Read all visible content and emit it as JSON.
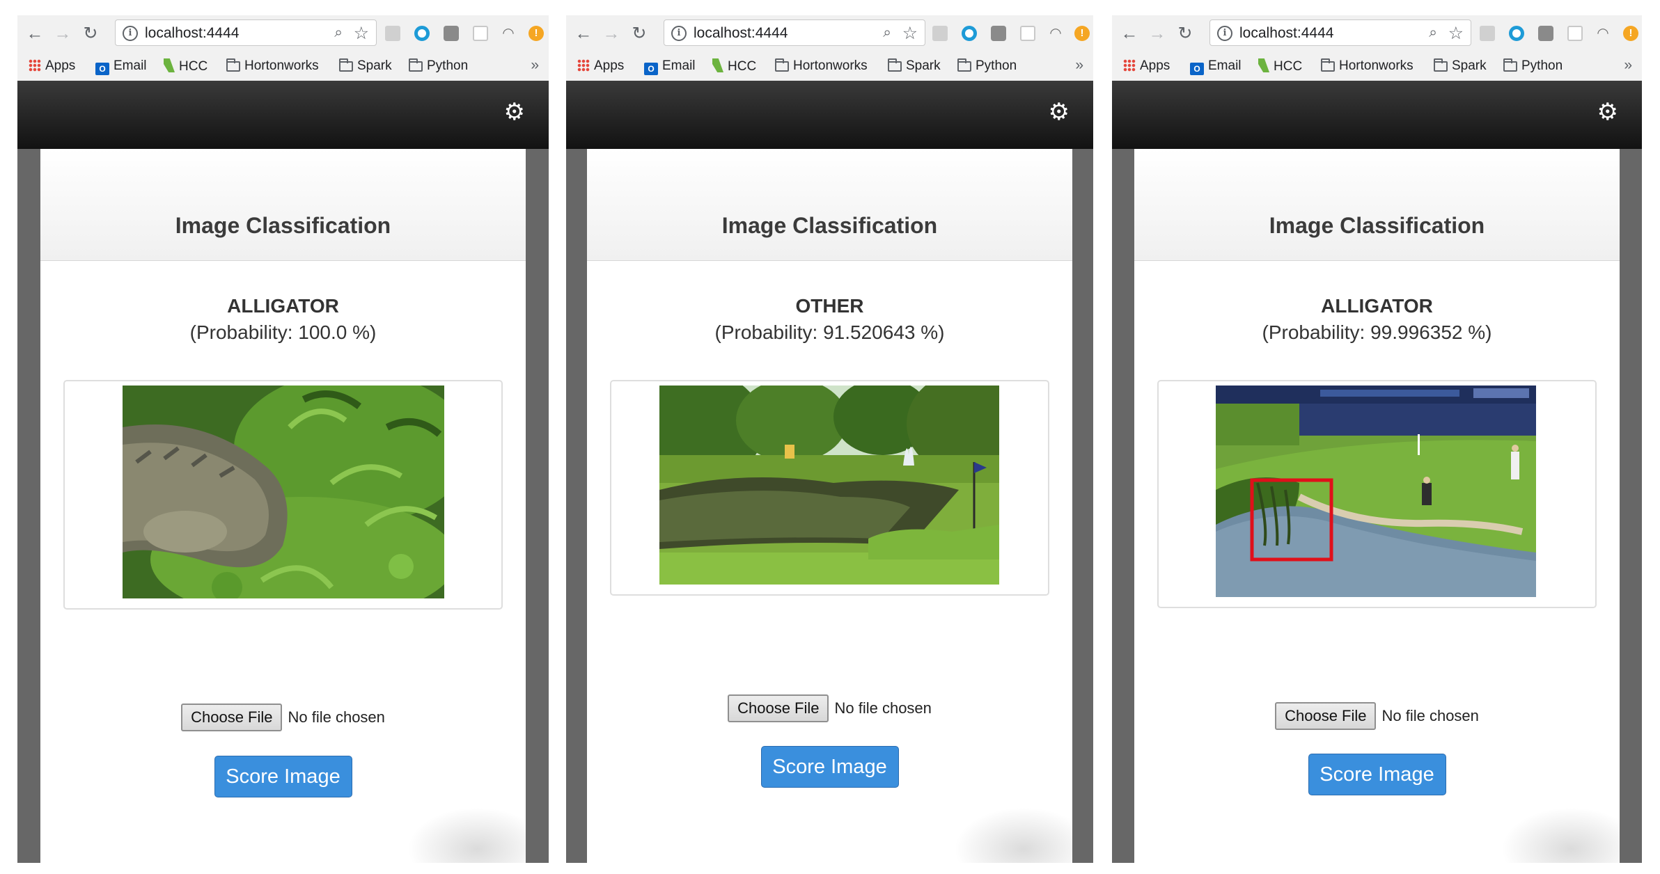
{
  "browser": {
    "url": "localhost:4444",
    "bookmarks": [
      "Apps",
      "Email",
      "HCC",
      "Hortonworks",
      "Spark",
      "Python"
    ],
    "more": "»"
  },
  "icons": {
    "back": "back-arrow-icon",
    "forward": "forward-arrow-icon",
    "reload": "reload-icon",
    "info": "info-icon",
    "zoom": "zoom-icon",
    "star": "bookmark-star-icon",
    "settings": "gear-icon"
  },
  "colors": {
    "app_bar": "#1f1f1f",
    "frame": "#676767",
    "score_button": "#3a8fdd",
    "detection_box": "#e0101a"
  },
  "panels": [
    {
      "title": "Image Classification",
      "label": "ALLIGATOR",
      "probability": "(Probability: 100.0 %)",
      "image": "alligator in grass",
      "choose_file": "Choose File",
      "file_status": "No file chosen",
      "score_button": "Score Image"
    },
    {
      "title": "Image Classification",
      "label": "OTHER",
      "probability": "(Probability: 91.520643 %)",
      "image": "golf course pond with fountain",
      "choose_file": "Choose File",
      "file_status": "No file chosen",
      "score_button": "Score Image"
    },
    {
      "title": "Image Classification",
      "label": "ALLIGATOR",
      "probability": "(Probability: 99.996352 %)",
      "image": "golf broadcast with alligator detection box",
      "choose_file": "Choose File",
      "file_status": "No file chosen",
      "score_button": "Score Image"
    }
  ]
}
